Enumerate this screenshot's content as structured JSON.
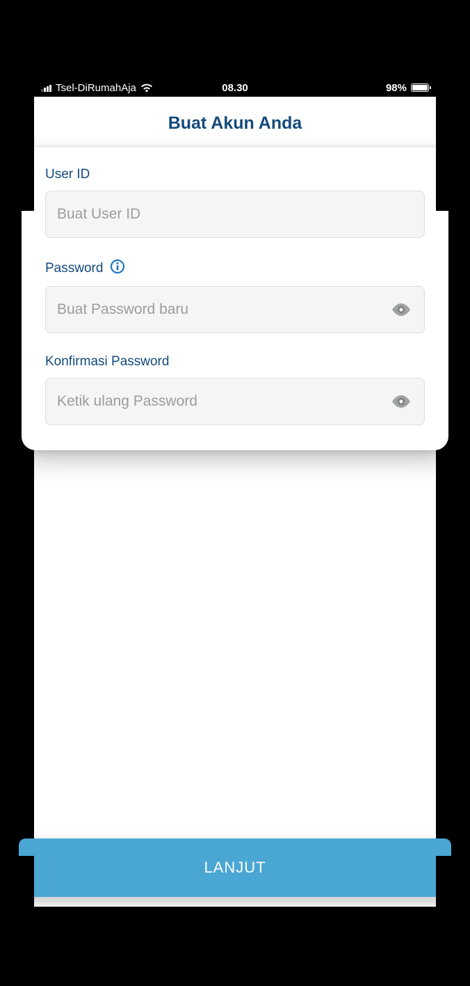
{
  "status_bar": {
    "carrier": "Tsel-DiRumahAja",
    "time": "08.30",
    "battery_percent": "98%"
  },
  "header": {
    "title": "Buat Akun Anda"
  },
  "form": {
    "user_id": {
      "label": "User ID",
      "placeholder": "Buat User ID",
      "value": ""
    },
    "password": {
      "label": "Password",
      "placeholder": "Buat Password baru",
      "value": ""
    },
    "confirm_password": {
      "label": "Konfirmasi Password",
      "placeholder": "Ketik ulang Password",
      "value": ""
    }
  },
  "footer": {
    "primary_button": "LANJUT"
  }
}
